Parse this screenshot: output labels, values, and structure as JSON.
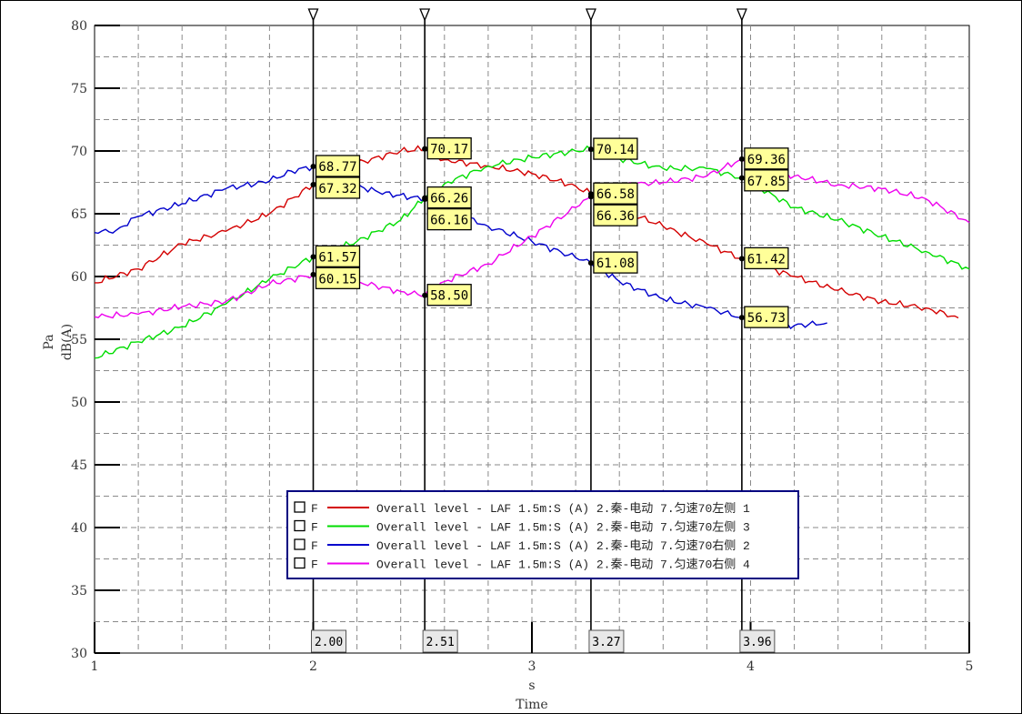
{
  "chart_data": {
    "type": "line",
    "xlabel_unit": "s",
    "xlabel": "Time",
    "ylabel_unit": "Pa",
    "ylabel": "dB(A)",
    "xlim": [
      1,
      5
    ],
    "ylim": [
      30,
      80
    ],
    "x_ticks": [
      "1",
      "2",
      "3",
      "4",
      "5"
    ],
    "y_ticks": [
      "30",
      "35",
      "40",
      "45",
      "50",
      "55",
      "60",
      "65",
      "70",
      "75",
      "80"
    ],
    "grid": true,
    "legend_position": "bottom-center",
    "series": [
      {
        "name": "Overall level - LAF 1.5m:S (A) 2.秦-电动 7.匀速70左侧 1",
        "flag": "F",
        "color": "#d40000",
        "x": [
          1.0,
          1.2,
          1.4,
          1.6,
          1.8,
          2.0,
          2.2,
          2.4,
          2.51,
          2.6,
          2.8,
          3.0,
          3.2,
          3.27,
          3.4,
          3.6,
          3.8,
          3.96,
          4.2,
          4.4,
          4.6,
          4.8,
          4.95
        ],
        "values": [
          59.5,
          60.6,
          62.6,
          63.6,
          65.0,
          67.32,
          69.0,
          70.0,
          70.17,
          69.3,
          68.8,
          68.2,
          67.2,
          66.58,
          65.4,
          64.0,
          62.6,
          61.42,
          60.0,
          58.9,
          58.0,
          57.5,
          56.7
        ]
      },
      {
        "name": "Overall level - LAF 1.5m:S (A) 2.秦-电动 7.匀速70左侧 3",
        "flag": "F",
        "color": "#00dd00",
        "x": [
          1.0,
          1.2,
          1.4,
          1.6,
          1.8,
          2.0,
          2.2,
          2.4,
          2.51,
          2.6,
          2.8,
          3.0,
          3.2,
          3.27,
          3.4,
          3.6,
          3.8,
          3.96,
          4.2,
          4.4,
          4.6,
          4.8,
          5.0
        ],
        "values": [
          53.5,
          54.8,
          56.0,
          57.8,
          59.8,
          61.57,
          62.8,
          64.5,
          66.26,
          67.4,
          68.8,
          69.5,
          70.0,
          70.14,
          69.4,
          68.6,
          68.6,
          67.85,
          65.5,
          64.5,
          63.2,
          62.0,
          60.6
        ]
      },
      {
        "name": "Overall level - LAF 1.5m:S (A) 2.秦-电动 7.匀速70右侧 2",
        "flag": "F",
        "color": "#0000cc",
        "x": [
          1.0,
          1.1,
          1.2,
          1.4,
          1.6,
          1.8,
          1.9,
          2.0,
          2.1,
          2.3,
          2.51,
          2.6,
          2.8,
          3.0,
          3.2,
          3.27,
          3.4,
          3.6,
          3.8,
          3.96,
          4.1,
          4.2,
          4.35
        ],
        "values": [
          63.5,
          63.7,
          64.8,
          65.8,
          67.0,
          67.6,
          68.4,
          68.77,
          67.8,
          66.7,
          66.16,
          65.4,
          64.0,
          62.8,
          61.5,
          61.08,
          59.6,
          58.2,
          57.5,
          56.73,
          56.3,
          56.1,
          56.3
        ]
      },
      {
        "name": "Overall level - LAF 1.5m:S (A) 2.秦-电动 7.匀速70右侧 4",
        "flag": "F",
        "color": "#ee00ee",
        "x": [
          1.0,
          1.2,
          1.4,
          1.6,
          1.8,
          2.0,
          2.2,
          2.4,
          2.51,
          2.6,
          2.8,
          3.0,
          3.2,
          3.27,
          3.4,
          3.6,
          3.8,
          3.96,
          4.2,
          4.4,
          4.6,
          4.8,
          5.0
        ],
        "values": [
          56.8,
          57.0,
          57.6,
          58.0,
          59.4,
          60.15,
          59.6,
          58.8,
          58.5,
          59.6,
          61.0,
          63.2,
          65.5,
          66.36,
          67.3,
          67.5,
          68.0,
          69.36,
          68.0,
          67.3,
          67.0,
          66.2,
          64.3
        ]
      }
    ],
    "cursors": [
      {
        "x": 2.0,
        "label": "2.00",
        "readouts": [
          "68.77",
          "67.32",
          "61.57",
          "60.15"
        ],
        "readout_values": [
          68.77,
          67.32,
          61.57,
          60.15
        ],
        "readout_series": [
          2,
          0,
          1,
          3
        ]
      },
      {
        "x": 2.51,
        "label": "2.51",
        "readouts": [
          "70.17",
          "66.26",
          "66.16",
          "58.50"
        ],
        "readout_values": [
          70.17,
          66.26,
          66.16,
          58.5
        ],
        "readout_series": [
          0,
          1,
          2,
          3
        ]
      },
      {
        "x": 3.27,
        "label": "3.27",
        "readouts": [
          "70.14",
          "66.58",
          "66.36",
          "61.08"
        ],
        "readout_values": [
          70.14,
          66.58,
          66.36,
          61.08
        ],
        "readout_series": [
          1,
          0,
          3,
          2
        ]
      },
      {
        "x": 3.96,
        "label": "3.96",
        "readouts": [
          "69.36",
          "67.85",
          "61.42",
          "56.73"
        ],
        "readout_values": [
          69.36,
          67.85,
          61.42,
          56.73
        ],
        "readout_series": [
          3,
          1,
          0,
          2
        ]
      }
    ]
  }
}
